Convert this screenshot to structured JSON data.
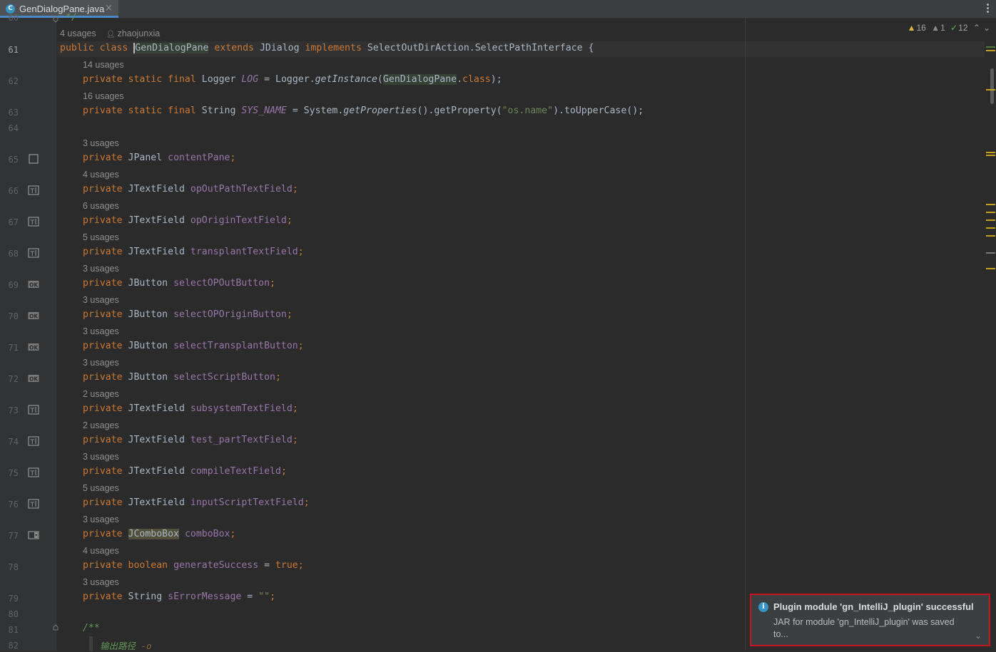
{
  "tab": {
    "icon_letter": "C",
    "label": "GenDialogPane.java",
    "close_glyph": "×",
    "accent": "#4a88c7"
  },
  "inspections": {
    "warnings": "16",
    "weak_warnings": "1",
    "ok": "12",
    "expand_glyph": "⌄"
  },
  "top_hint": {
    "usages": "4 usages",
    "author": "zhaojunxia"
  },
  "gutter": {
    "line_numbers": [
      "60",
      "61",
      "62",
      "63",
      "64",
      "65",
      "66",
      "67",
      "68",
      "69",
      "70",
      "71",
      "72",
      "73",
      "74",
      "75",
      "76",
      "77",
      "78",
      "79",
      "80",
      "81",
      "82"
    ],
    "icons": [
      "panel-icon",
      "textfield-icon",
      "textfield-icon",
      "textfield-icon",
      "button-icon",
      "button-icon",
      "button-icon",
      "button-icon",
      "textfield-icon",
      "textfield-icon",
      "textfield-icon",
      "textfield-icon",
      "combobox-icon"
    ]
  },
  "code": {
    "top_comment": "*/",
    "class_decl": {
      "kw1": "public",
      "kw2": "class",
      "name": "GenDialogPane",
      "kw3": "extends",
      "parent": "JDialog",
      "kw4": "implements",
      "iface": "SelectOutDirAction.SelectPathInterface",
      "brace": " {"
    },
    "log_line": {
      "mods": "private static final",
      "type": "Logger",
      "name": "LOG",
      "eq": " = ",
      "cls": "Logger.",
      "method": "getInstance",
      "open": "(",
      "arg": "GenDialogPane",
      "dot": ".",
      "classkw": "class",
      "close": ");"
    },
    "sys_line": {
      "mods": "private static final",
      "type": "String",
      "name": "SYS_NAME",
      "eq": " = ",
      "cls": "System.",
      "method": "getProperties",
      "mid": "().getProperty(",
      "str": "\"os.name\"",
      "close": ").toUpperCase();"
    },
    "fields": [
      {
        "usages": "3 usages",
        "type": "JPanel",
        "name": "contentPane"
      },
      {
        "usages": "4 usages",
        "type": "JTextField",
        "name": "opOutPathTextField"
      },
      {
        "usages": "6 usages",
        "type": "JTextField",
        "name": "opOriginTextField"
      },
      {
        "usages": "5 usages",
        "type": "JTextField",
        "name": "transplantTextField"
      },
      {
        "usages": "3 usages",
        "type": "JButton",
        "name": "selectOPOutButton"
      },
      {
        "usages": "3 usages",
        "type": "JButton",
        "name": "selectOPOriginButton"
      },
      {
        "usages": "3 usages",
        "type": "JButton",
        "name": "selectTransplantButton"
      },
      {
        "usages": "3 usages",
        "type": "JButton",
        "name": "selectScriptButton"
      },
      {
        "usages": "2 usages",
        "type": "JTextField",
        "name": "subsystemTextField"
      },
      {
        "usages": "2 usages",
        "type": "JTextField",
        "name": "test_partTextField"
      },
      {
        "usages": "3 usages",
        "type": "JTextField",
        "name": "compileTextField"
      },
      {
        "usages": "5 usages",
        "type": "JTextField",
        "name": "inputScriptTextField"
      },
      {
        "usages": "3 usages",
        "type": "JComboBox",
        "name": "comboBox"
      }
    ],
    "bool_line": {
      "usages": "4 usages",
      "kw": "private",
      "type": "boolean",
      "name": "generateSuccess",
      "eq": " = ",
      "val": "true",
      "semi": ";"
    },
    "err_line": {
      "usages": "3 usages",
      "kw": "private",
      "type": "String",
      "name": "sErrorMessage",
      "eq": " = ",
      "val": "\"\"",
      "semi": ";"
    },
    "private_kw": "private",
    "semi": ";",
    "doc_open": "/**",
    "doc_text": "输出路径 ",
    "doc_tag": "-o",
    "usages_hints": [
      "14 usages",
      "16 usages"
    ]
  },
  "notification": {
    "title": "Plugin module 'gn_IntelliJ_plugin' successful",
    "body": "JAR for module 'gn_IntelliJ_plugin' was saved to...",
    "expand": "⌄",
    "border": "#c4161c"
  }
}
